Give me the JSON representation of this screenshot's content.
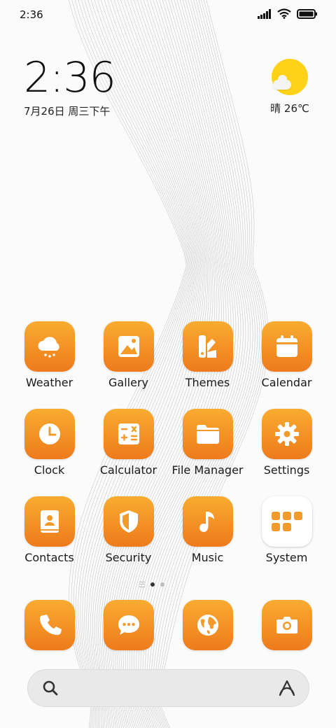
{
  "status_bar": {
    "time": "2:36"
  },
  "clock_widget": {
    "time": "2:36",
    "date": "7月26日 周三下午"
  },
  "weather_widget": {
    "text": "晴 26℃"
  },
  "apps": [
    {
      "label": "Weather",
      "icon": "cloud-icon"
    },
    {
      "label": "Gallery",
      "icon": "image-icon"
    },
    {
      "label": "Themes",
      "icon": "palette-icon"
    },
    {
      "label": "Calendar",
      "icon": "calendar-icon"
    },
    {
      "label": "Clock",
      "icon": "clock-icon"
    },
    {
      "label": "Calculator",
      "icon": "calculator-icon"
    },
    {
      "label": "File Manager",
      "icon": "folder-icon"
    },
    {
      "label": "Settings",
      "icon": "gear-icon"
    },
    {
      "label": "Contacts",
      "icon": "contacts-icon"
    },
    {
      "label": "Security",
      "icon": "shield-icon"
    },
    {
      "label": "Music",
      "icon": "music-note-icon"
    },
    {
      "label": "System",
      "icon": "folder-grid-icon"
    }
  ],
  "dock": [
    {
      "icon": "phone-icon"
    },
    {
      "icon": "message-icon"
    },
    {
      "icon": "globe-icon"
    },
    {
      "icon": "camera-icon"
    }
  ],
  "page_indicator": {
    "pages": 2,
    "current": 1
  },
  "colors": {
    "accent_top": "#f9ac30",
    "accent_bottom": "#ee7a1c",
    "sun": "#ffd21a"
  }
}
